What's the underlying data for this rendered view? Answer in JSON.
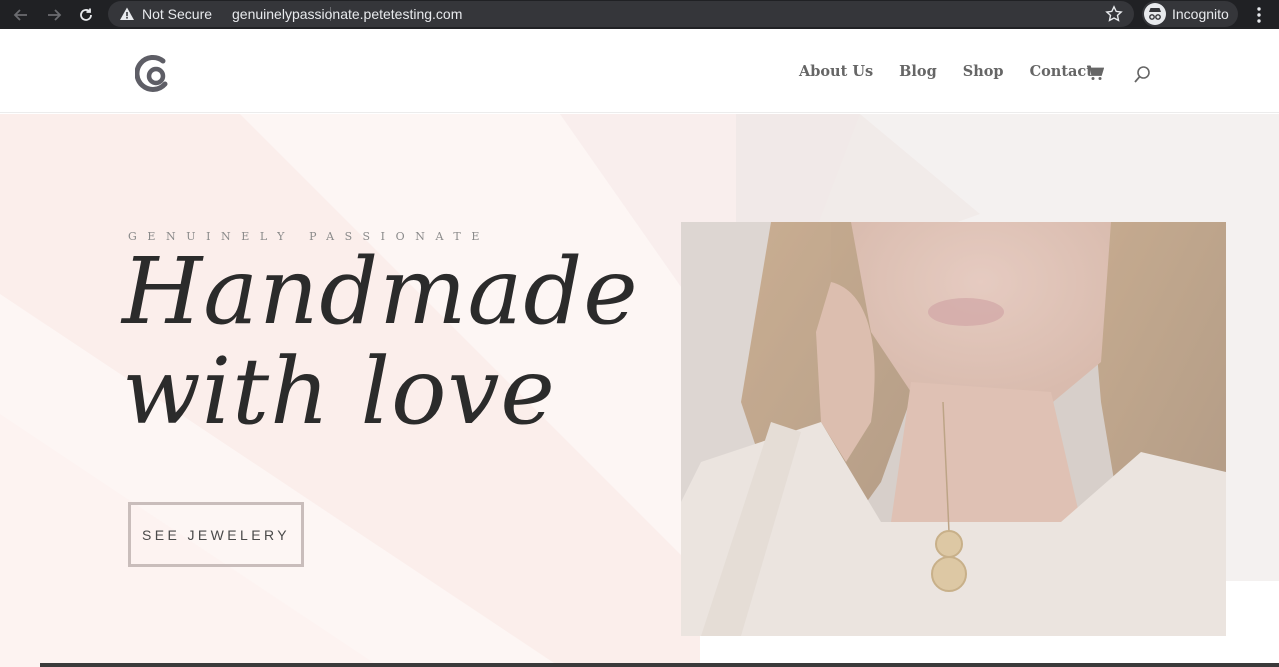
{
  "browser": {
    "security_label": "Not Secure",
    "url": "genuinelypassionate.petetesting.com",
    "profile_label": "Incognito",
    "icons": [
      "back-arrow-icon",
      "forward-arrow-icon",
      "reload-icon",
      "warning-icon",
      "bookmark-star-icon",
      "incognito-icon",
      "kebab-menu-icon"
    ]
  },
  "site": {
    "logo_name": "site-logo",
    "nav": [
      {
        "label": "About Us"
      },
      {
        "label": "Blog"
      },
      {
        "label": "Shop"
      },
      {
        "label": "Contact"
      }
    ],
    "icons": [
      "cart-icon",
      "search-icon"
    ]
  },
  "hero": {
    "eyebrow": "GENUINELY PASSIONATE",
    "headline_line1": "Handmade",
    "headline_line2": "with love",
    "cta_label": "SEE JEWELERY",
    "image_name": "woman-with-necklace-photo"
  },
  "colors": {
    "chrome_bg": "#202124",
    "omnibox_bg": "#35363a",
    "nav_text": "#666666",
    "headline": "#2b2b2b",
    "cta_border": "#c9bdbb",
    "hero_blush": "#fbf1ef"
  }
}
